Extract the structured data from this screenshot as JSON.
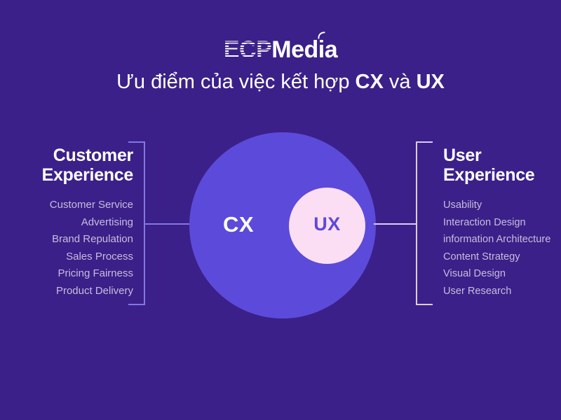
{
  "header": {
    "logo": {
      "part_striped": "ECP",
      "part_solid": "Media",
      "signal_arc_icon": "signal-arc-icon"
    },
    "subtitle": {
      "text_before": "Ưu điểm của việc kết hợp ",
      "bold_1": "CX",
      "text_middle": " và ",
      "bold_2": "UX"
    }
  },
  "left_column": {
    "title": "Customer\nExperience",
    "title_line_1": "Customer",
    "title_line_2": "Experience",
    "items": [
      "Customer Service",
      "Advertising",
      "Brand Repulation",
      "Sales Process",
      "Pricing Fairness",
      "Product Delivery"
    ]
  },
  "right_column": {
    "title_line_1": "User",
    "title_line_2": "Experience",
    "items": [
      "Usability",
      "Interaction Design",
      "information Architecture",
      "Content Strategy",
      "Visual Design",
      "User Research"
    ]
  },
  "diagram": {
    "outer_circle_label": "CX",
    "inner_circle_label": "UX"
  },
  "colors": {
    "background": "#3b2089",
    "outer_circle": "#5c4ada",
    "inner_circle": "#fbdef4",
    "inner_label": "#5c4ada",
    "bracket_left": "#8376e4",
    "bracket_right": "#d9cdf0",
    "list_text": "#c6bcdd",
    "heading_text": "#ffffff"
  }
}
